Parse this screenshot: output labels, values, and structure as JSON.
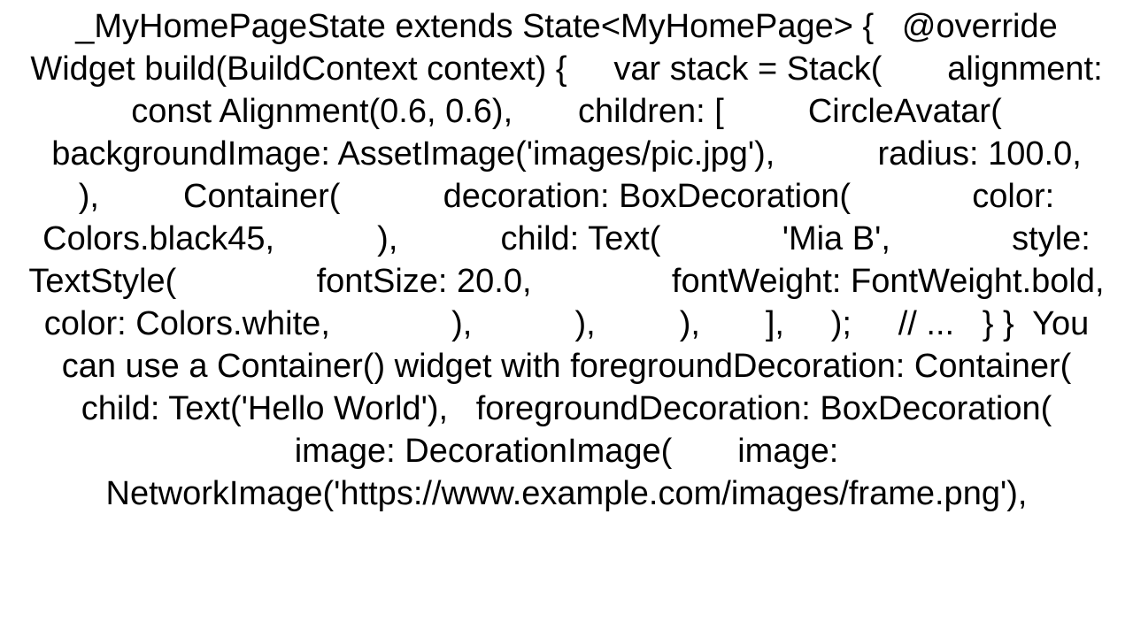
{
  "document": {
    "body": "_MyHomePageState extends State<MyHomePage> {   @override   Widget build(BuildContext context) {     var stack = Stack(       alignment: const Alignment(0.6, 0.6),       children: [         CircleAvatar(           backgroundImage: AssetImage('images/pic.jpg'),           radius: 100.0,         ),         Container(           decoration: BoxDecoration(             color: Colors.black45,           ),           child: Text(             'Mia B',             style: TextStyle(               fontSize: 20.0,               fontWeight: FontWeight.bold,               color: Colors.white,             ),           ),         ),       ],     );     // ...   } }  You can use a Container() widget with foregroundDecoration: Container(   child: Text('Hello World'),   foregroundDecoration: BoxDecoration(     image: DecorationImage(       image: NetworkImage('https://www.example.com/images/frame.png'),"
  }
}
